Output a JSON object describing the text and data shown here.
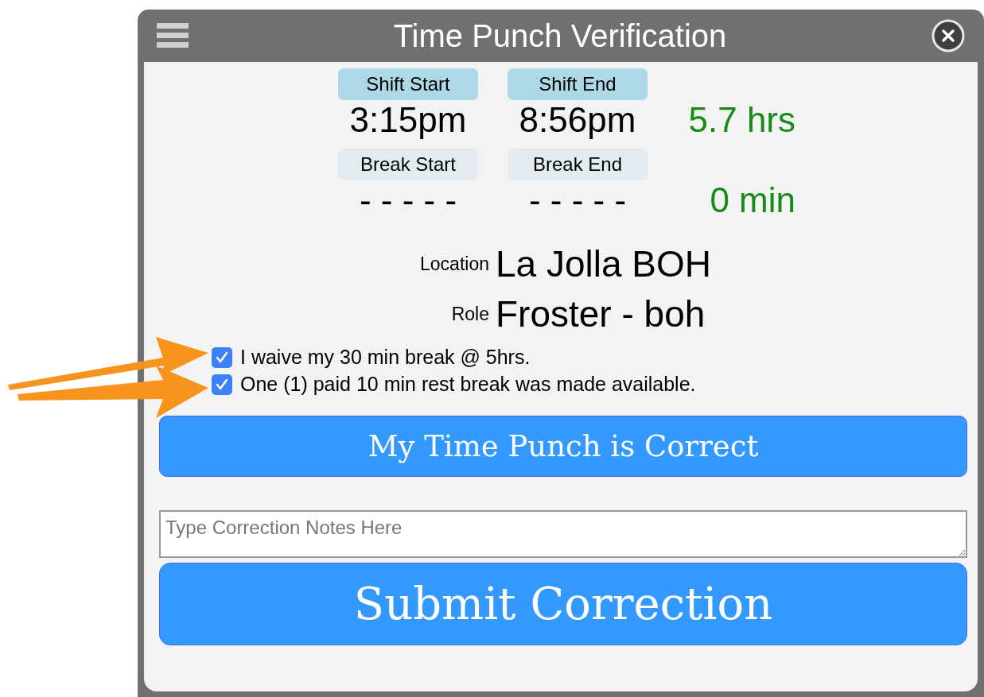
{
  "window": {
    "title": "Time Punch Verification"
  },
  "times": [
    {
      "kind": "shift",
      "start_label": "Shift Start",
      "start": "3:15pm",
      "end_label": "Shift End",
      "end": "8:56pm",
      "total": "5.7 hrs"
    },
    {
      "kind": "break",
      "start_label": "Break Start",
      "start": "- - - - -",
      "end_label": "Break End",
      "end": "- - - - -",
      "total": "0 min"
    }
  ],
  "details": [
    {
      "label": "Location",
      "value": "La Jolla BOH"
    },
    {
      "label": "Role",
      "value": "Froster - boh"
    }
  ],
  "attestations": [
    {
      "label": "I waive my 30 min break @ 5hrs.",
      "checked": true
    },
    {
      "label": "One (1) paid 10 min rest break was made available.",
      "checked": true
    }
  ],
  "confirm_button": "My Time Punch is Correct",
  "notes": {
    "placeholder": "Type Correction Notes Here"
  },
  "submit_button": "Submit Correction"
}
